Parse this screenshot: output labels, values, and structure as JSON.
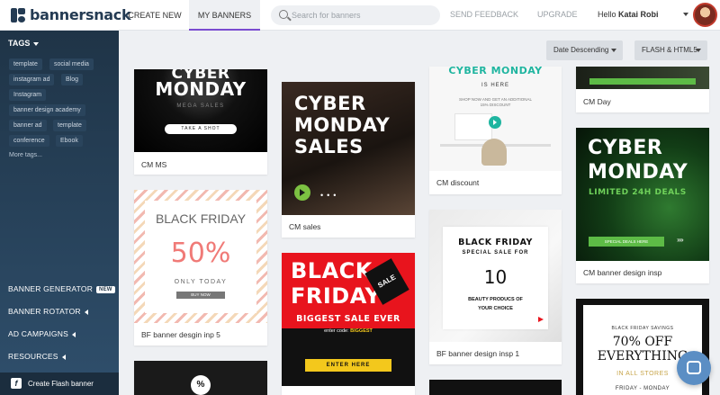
{
  "brand": {
    "name": "bannersnack"
  },
  "nav": {
    "create_new": "CREATE NEW",
    "my_banners": "MY BANNERS"
  },
  "search": {
    "placeholder": "Search for banners"
  },
  "top_links": {
    "feedback": "SEND FEEDBACK",
    "upgrade": "UPGRADE"
  },
  "user": {
    "hello": "Hello",
    "name": "Katai Robi"
  },
  "sidebar": {
    "tags_label": "TAGS",
    "tags": [
      "template",
      "social media",
      "instagram ad",
      "Blog",
      "Instagram",
      "banner design academy",
      "banner ad",
      "template",
      "conference",
      "Ebook"
    ],
    "more_tags": "More tags...",
    "banner_generator": "BANNER GENERATOR",
    "new_badge": "NEW",
    "banner_rotator": "BANNER ROTATOR",
    "ad_campaigns": "AD CAMPAIGNS",
    "resources": "RESOURCES",
    "create_flash": "Create Flash banner"
  },
  "filters": {
    "sort": "Date Descending",
    "type": "FLASH & HTML5"
  },
  "cards": {
    "cm_ms": {
      "caption": "CM MS",
      "line1": "CYBER",
      "line2": "MONDAY",
      "sub": "MEGA SALES",
      "btn": "TAKE A SHOT"
    },
    "cm_sales": {
      "caption": "CM sales",
      "line1": "CYBER",
      "line2": "MONDAY",
      "line3": "SALES"
    },
    "bf_5": {
      "caption": "BF banner desgin inp 5",
      "title": "BLACK FRIDAY",
      "pct": "50%",
      "only": "ONLY TODAY",
      "btn": "BUY NOW"
    },
    "bf_red": {
      "line1": "BLACK",
      "line2": "FRIDAY",
      "sale_tag": "SALE",
      "biggest": "BIGGEST SALE EVER",
      "code_label": "enter code:",
      "code": "BIGGEST",
      "btn": "ENTER HERE"
    },
    "cm_discount": {
      "caption": "CM discount",
      "title": "CYBER MONDAY",
      "sub": "IS HERE",
      "copy": "SHOP NOW AND GET AN ADDITIONAL 15% DISCOUNT"
    },
    "bf_insp1": {
      "caption": "BF banner design insp 1",
      "title": "BLACK FRIDAY",
      "special": "SPECIAL SALE FOR",
      "num": "10",
      "line1": "BEAUTY PRODUCS OF",
      "line2": "YOUR CHOICE"
    },
    "cm_day": {
      "caption": "CM Day"
    },
    "cm_insp": {
      "caption": "CM banner design insp",
      "line1": "CYBER",
      "line2": "MONDAY",
      "sub": "LIMITED 24H DEALS",
      "btn": "SPECIAL DEALS HERE"
    },
    "bf_70": {
      "top": "BLACK FRIDAY SAVINGS",
      "line1": "70% OFF",
      "line2": "EVERYTHING",
      "stores": "IN ALL STORES",
      "days": "FRIDAY - MONDAY"
    }
  },
  "colors": {
    "accent": "#7a4bd0",
    "cyber_green": "#39c46b",
    "teal": "#1fb5a0",
    "bf_red": "#e8141d",
    "enter_yellow": "#f3c81c",
    "sidebar_dark": "#1f3447"
  }
}
